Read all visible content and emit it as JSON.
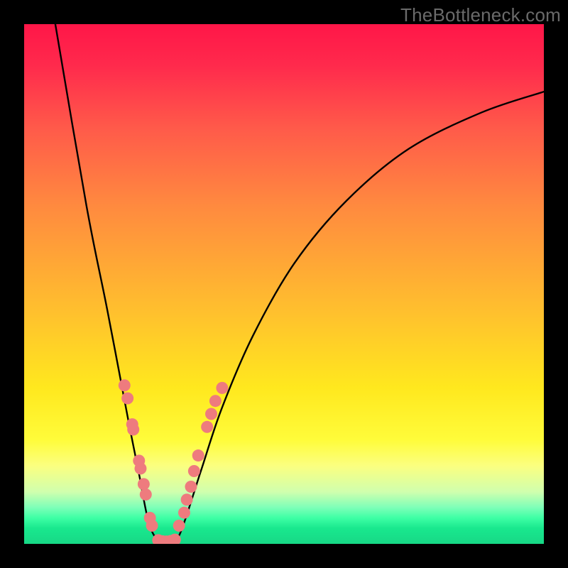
{
  "watermark": "TheBottleneck.com",
  "chart_data": {
    "type": "line",
    "title": "",
    "xlabel": "",
    "ylabel": "",
    "xlim": [
      0,
      100
    ],
    "ylim": [
      0,
      100
    ],
    "background_gradient": {
      "top_color": "#ff1648",
      "mid_color": "#ffe81e",
      "bottom_color": "#17d886"
    },
    "series": [
      {
        "name": "curve",
        "kind": "path",
        "color": "#000000",
        "points": [
          {
            "x": 6,
            "y": 100
          },
          {
            "x": 12,
            "y": 65
          },
          {
            "x": 16,
            "y": 45
          },
          {
            "x": 20,
            "y": 24
          },
          {
            "x": 22,
            "y": 14
          },
          {
            "x": 24,
            "y": 4
          },
          {
            "x": 26,
            "y": 0.5
          },
          {
            "x": 28,
            "y": 0.4
          },
          {
            "x": 30,
            "y": 2
          },
          {
            "x": 34,
            "y": 14
          },
          {
            "x": 38,
            "y": 26
          },
          {
            "x": 44,
            "y": 40
          },
          {
            "x": 52,
            "y": 54
          },
          {
            "x": 62,
            "y": 66
          },
          {
            "x": 74,
            "y": 76
          },
          {
            "x": 88,
            "y": 83
          },
          {
            "x": 100,
            "y": 87
          }
        ]
      },
      {
        "name": "dots-left",
        "kind": "scatter",
        "color": "#ee7b7e",
        "points": [
          {
            "x": 19.3,
            "y": 30.5
          },
          {
            "x": 19.9,
            "y": 28.0
          },
          {
            "x": 20.8,
            "y": 23.0
          },
          {
            "x": 21.0,
            "y": 22.0
          },
          {
            "x": 22.1,
            "y": 16.0
          },
          {
            "x": 22.4,
            "y": 14.5
          },
          {
            "x": 23.0,
            "y": 11.5
          },
          {
            "x": 23.4,
            "y": 9.5
          },
          {
            "x": 24.2,
            "y": 5.0
          },
          {
            "x": 24.6,
            "y": 3.5
          }
        ]
      },
      {
        "name": "dots-right",
        "kind": "scatter",
        "color": "#ee7b7e",
        "points": [
          {
            "x": 29.8,
            "y": 3.5
          },
          {
            "x": 30.8,
            "y": 6.0
          },
          {
            "x": 31.3,
            "y": 8.5
          },
          {
            "x": 32.1,
            "y": 11.0
          },
          {
            "x": 32.7,
            "y": 14.0
          },
          {
            "x": 33.5,
            "y": 17.0
          },
          {
            "x": 35.2,
            "y": 22.5
          },
          {
            "x": 36.0,
            "y": 25.0
          },
          {
            "x": 36.8,
            "y": 27.5
          },
          {
            "x": 38.1,
            "y": 30.0
          }
        ]
      },
      {
        "name": "dots-bottom",
        "kind": "scatter",
        "color": "#ee7b7e",
        "points": [
          {
            "x": 25.8,
            "y": 0.7
          },
          {
            "x": 26.6,
            "y": 0.5
          },
          {
            "x": 27.4,
            "y": 0.45
          },
          {
            "x": 28.2,
            "y": 0.55
          },
          {
            "x": 29.0,
            "y": 0.8
          }
        ]
      }
    ]
  }
}
